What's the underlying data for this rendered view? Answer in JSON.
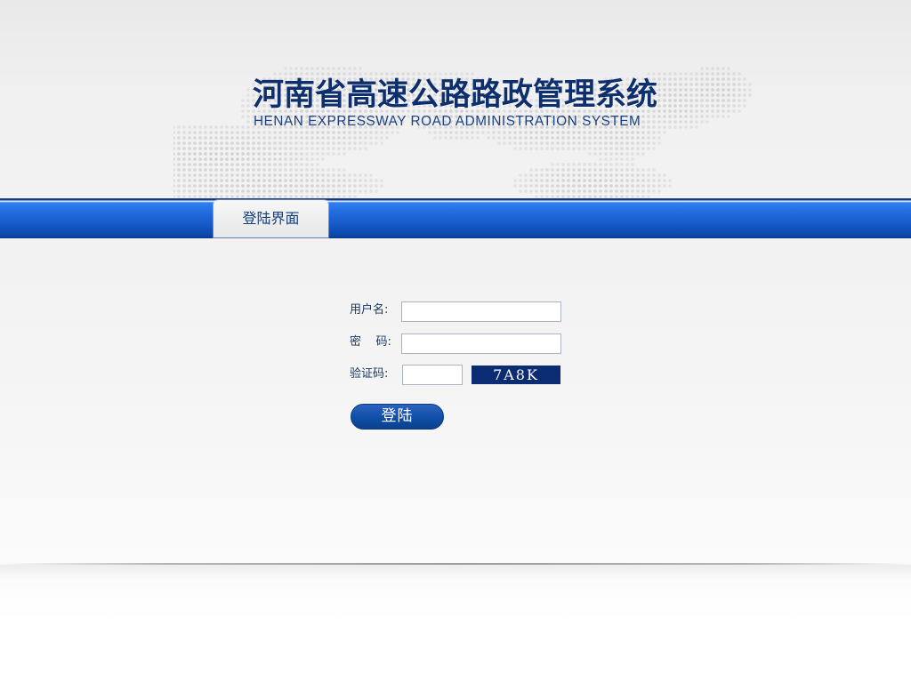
{
  "header": {
    "title_zh": "河南省高速公路路政管理系统",
    "title_en": "HENAN EXPRESSWAY ROAD ADMINISTRATION SYSTEM"
  },
  "nav": {
    "tab_label": "登陆界面"
  },
  "form": {
    "username_label": "用户名:",
    "username_value": "",
    "username_placeholder": "",
    "password_label": "密    码:",
    "password_value": "",
    "password_placeholder": "",
    "captcha_label": "验证码:",
    "captcha_value": "",
    "captcha_placeholder": "",
    "captcha_code": "7A8K",
    "login_button": "登陆"
  },
  "colors": {
    "primary": "#0f4fa8",
    "primary_dark": "#0b2c73",
    "title": "#0e2f6e",
    "background": "#f2f2f2"
  },
  "icons": {
    "map_background": "dotted-world-map-icon"
  }
}
